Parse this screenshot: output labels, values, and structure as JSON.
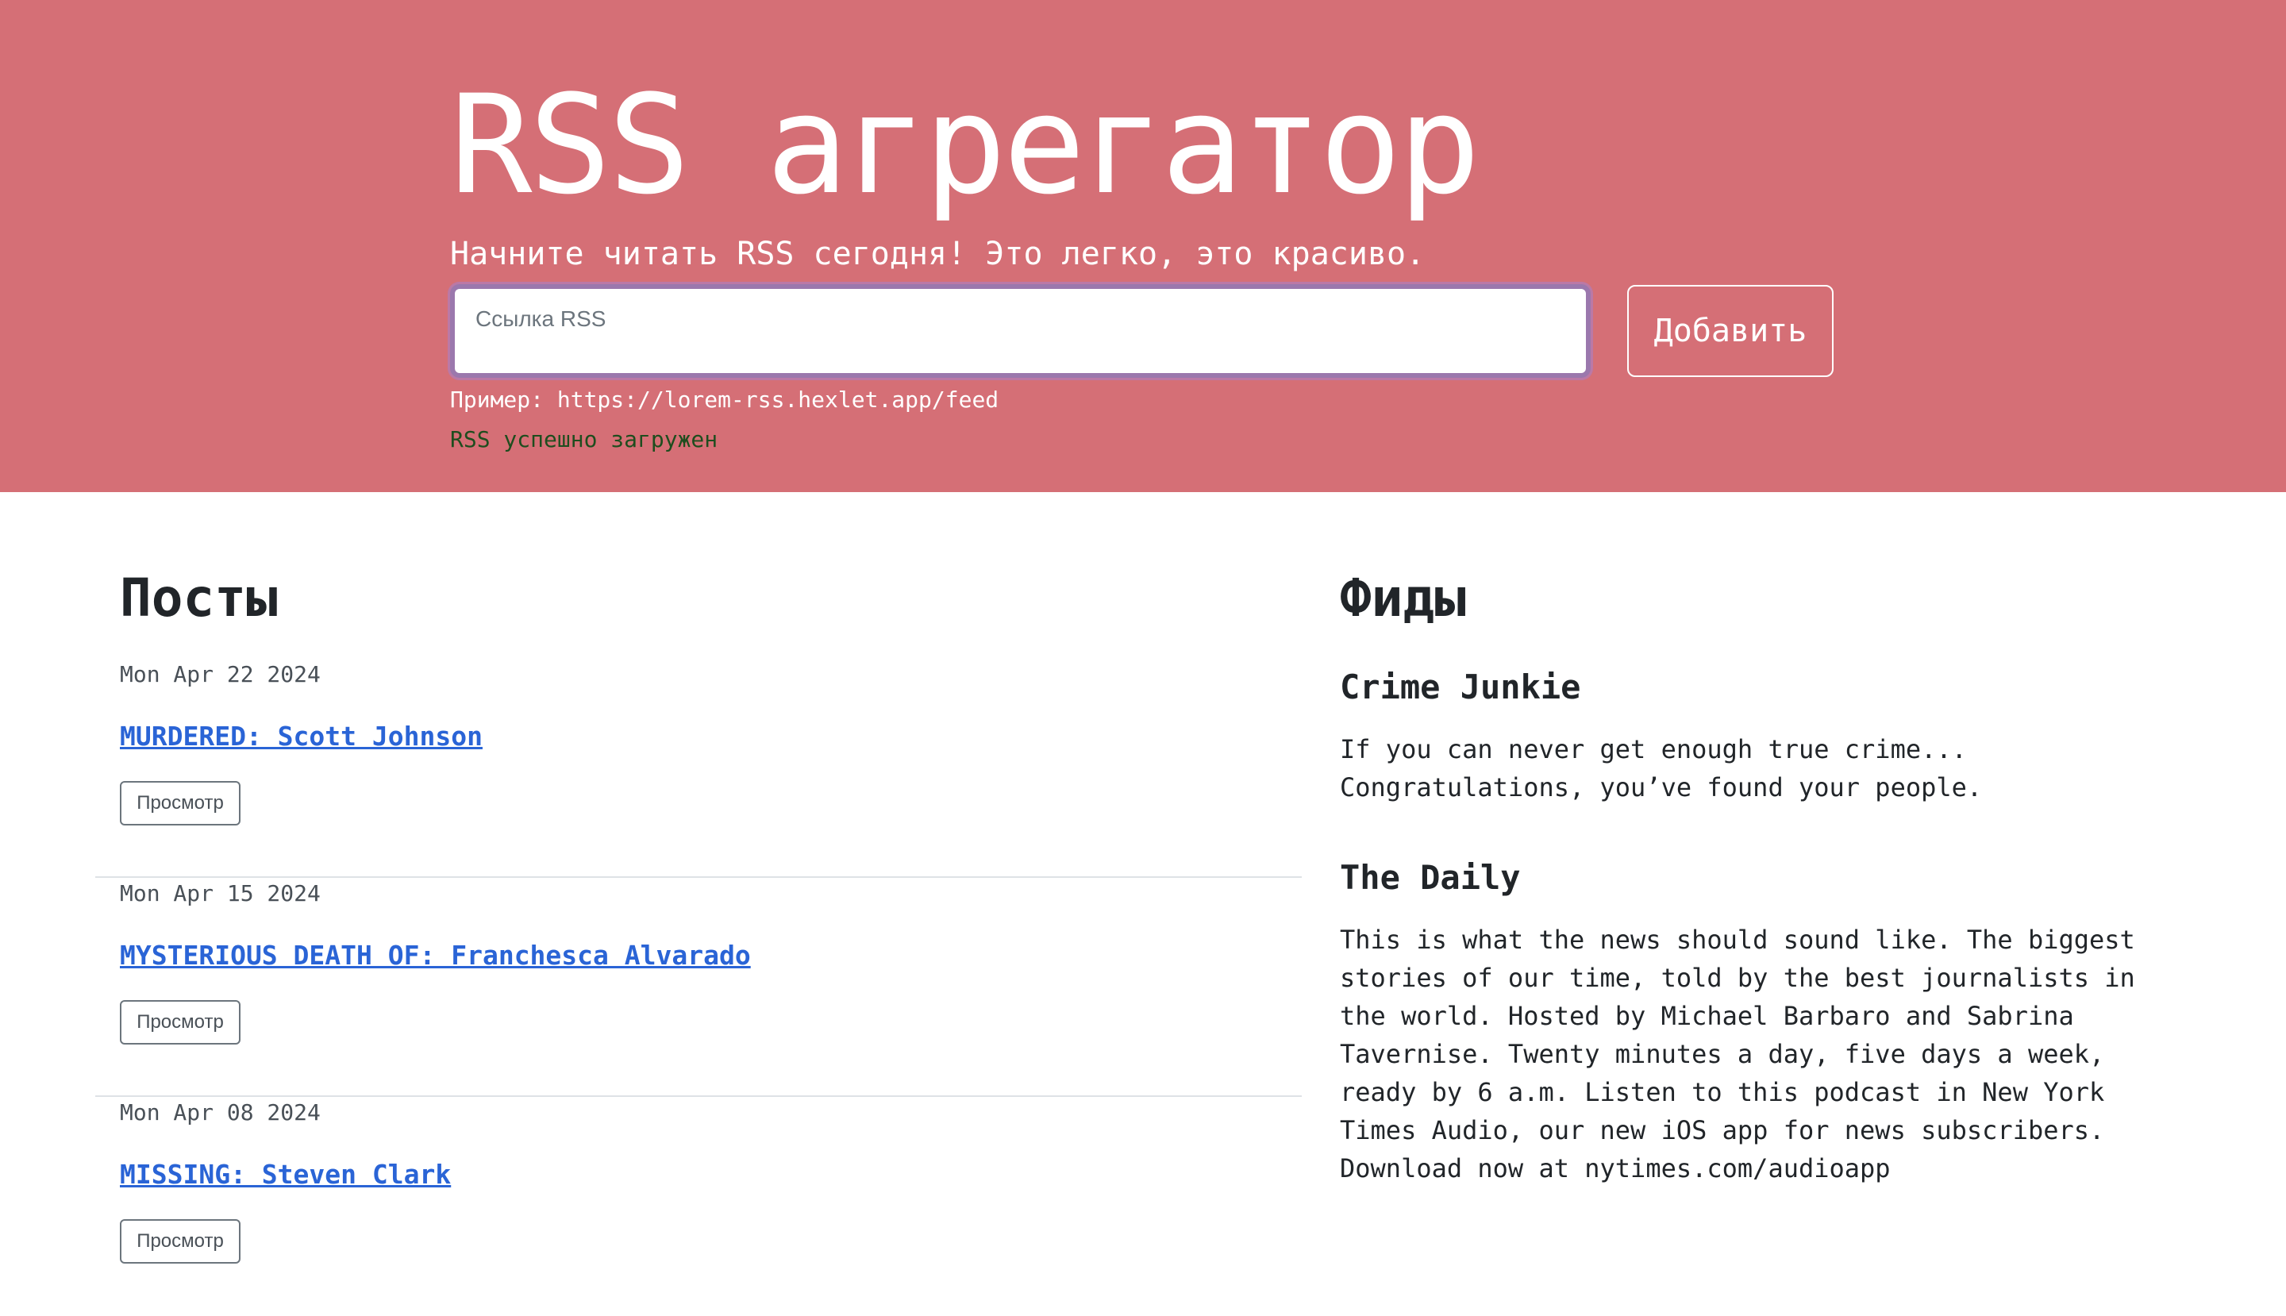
{
  "hero": {
    "title": "RSS агрегатор",
    "lead": "Начните читать RSS сегодня! Это легко, это красиво.",
    "input_label": "Ссылка RSS",
    "add_button": "Добавить",
    "example": "Пример: https://lorem-rss.hexlet.app/feed",
    "feedback": "RSS успешно загружен"
  },
  "posts": {
    "title": "Посты",
    "items": [
      {
        "date": "Mon Apr 22 2024",
        "title": "MURDERED: Scott Johnson",
        "button": "Просмотр"
      },
      {
        "date": "Mon Apr 15 2024",
        "title": "MYSTERIOUS DEATH OF: Franchesca Alvarado",
        "button": "Просмотр"
      },
      {
        "date": "Mon Apr 08 2024",
        "title": "MISSING: Steven Clark",
        "button": "Просмотр"
      }
    ]
  },
  "feeds": {
    "title": "Фиды",
    "items": [
      {
        "title": "Crime Junkie",
        "description": "If you can never get enough true crime... Congratulations, you’ve found your people."
      },
      {
        "title": "The Daily",
        "description": "This is what the news should sound like. The biggest stories of our time, told by the best journalists in the world. Hosted by Michael Barbaro and Sabrina Tavernise. Twenty minutes a day, five days a week, ready by 6 a.m. Listen to this podcast in New York Times Audio, our new iOS app for news subscribers. Download now at nytimes.com/audioapp"
      }
    ]
  },
  "colors": {
    "hero_bg": "#d56f76",
    "link": "#2a64d6",
    "feedback_text": "#1e4d1e"
  }
}
